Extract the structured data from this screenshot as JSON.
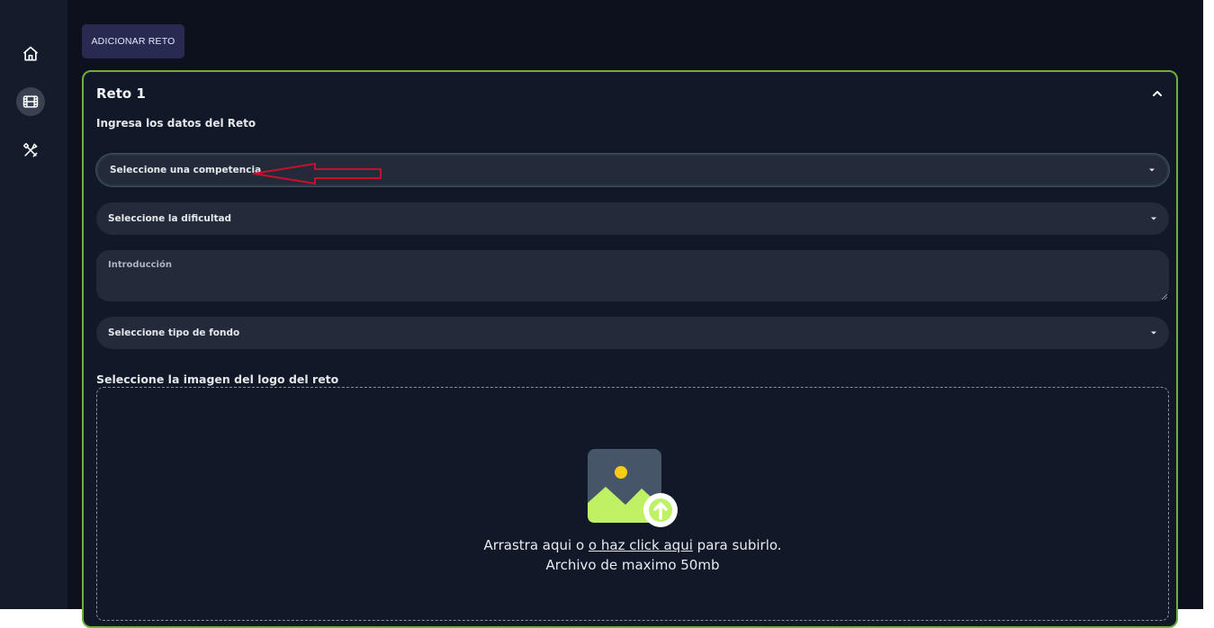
{
  "toolbar": {
    "add_challenge_label": "ADICIONAR RETO"
  },
  "sidebar": {
    "items": [
      {
        "icon": "home-icon"
      },
      {
        "icon": "film-icon",
        "active": true
      },
      {
        "icon": "tools-icon"
      }
    ]
  },
  "challenge": {
    "title": "Reto 1",
    "subtitle": "Ingresa los datos del Reto",
    "competition_select": "Seleccione una competencia",
    "difficulty_select": "Seleccione la dificultad",
    "intro_placeholder": "Introducción",
    "background_select": "Seleccione tipo de fondo",
    "logo_label": "Seleccione la imagen del logo del reto",
    "dropzone": {
      "text_before": "Arrastra aqui o",
      "link": "o haz click aqui",
      "text_after": "para subirlo.",
      "limit": "Archivo de maximo 50mb"
    }
  },
  "colors": {
    "accent_border": "#6fae3b",
    "annotation_arrow": "#c8102e",
    "image_icon_green": "#bef264",
    "image_icon_sun": "#facc15"
  }
}
